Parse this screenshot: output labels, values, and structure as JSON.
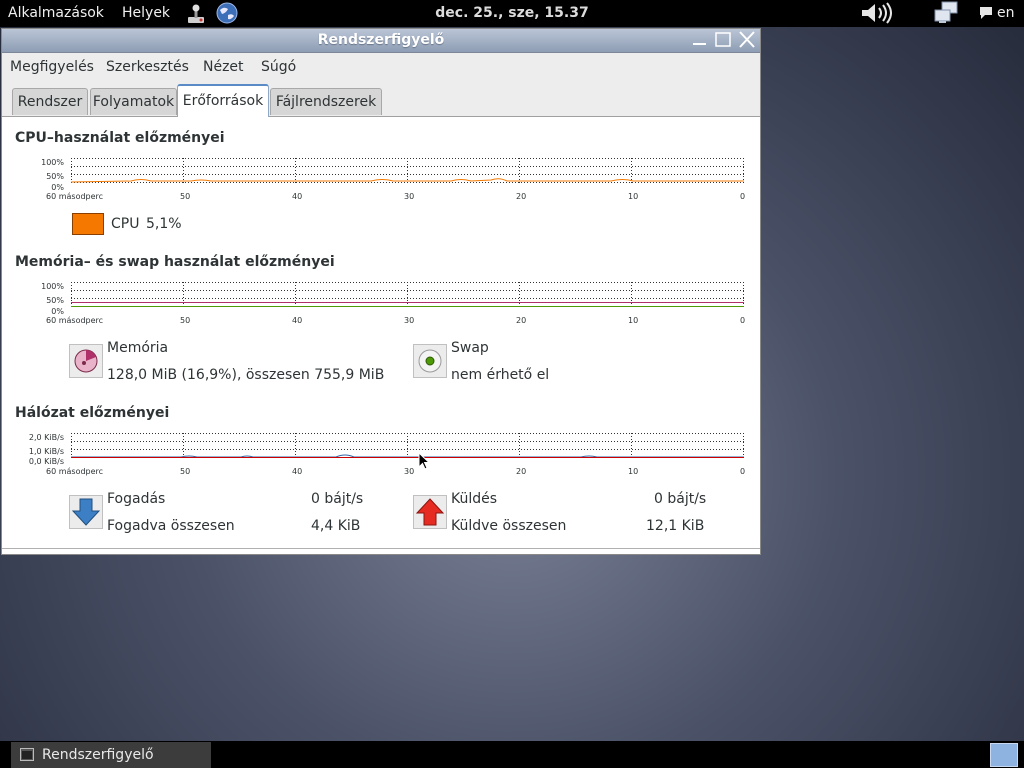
{
  "top_panel": {
    "applications": "Alkalmazások",
    "places": "Helyek",
    "clock": "dec. 25., sze, 15.37",
    "keyboard_layout": "en",
    "icons": [
      "joystick-icon",
      "globe-browser-icon",
      "volume-icon",
      "network-icon",
      "chat-icon"
    ]
  },
  "window": {
    "title": "Rendszerfigyelő",
    "menus": [
      "Megfigyelés",
      "Szerkesztés",
      "Nézet",
      "Súgó"
    ],
    "tabs": [
      "Rendszer",
      "Folyamatok",
      "Erőforrások",
      "Fájlrendszerek"
    ],
    "active_tab": "Erőforrások"
  },
  "cpu": {
    "title": "CPU–használat előzményei",
    "y_labels": [
      "100%",
      "50%",
      "0%"
    ],
    "x_labels": [
      "60 másodperc",
      "50",
      "40",
      "30",
      "20",
      "10",
      "0"
    ],
    "legend_label": "CPU",
    "legend_value": "5,1%",
    "color": "#f57900"
  },
  "memory": {
    "title": "Memória– és swap használat előzményei",
    "y_labels": [
      "100%",
      "50%",
      "0%"
    ],
    "x_labels": [
      "60 másodperc",
      "50",
      "40",
      "30",
      "20",
      "10",
      "0"
    ],
    "mem_label": "Memória",
    "mem_value": "128,0 MiB (16,9%), összesen 755,9 MiB",
    "swap_label": "Swap",
    "swap_value": "nem érhető el",
    "mem_color": "#b0306a",
    "swap_color": "#4e9a06"
  },
  "network": {
    "title": "Hálózat előzményei",
    "y_labels": [
      "2,0 KiB/s",
      "1,0 KiB/s",
      "0,0 KiB/s"
    ],
    "x_labels": [
      "60 másodperc",
      "50",
      "40",
      "30",
      "20",
      "10",
      "0"
    ],
    "recv_label": "Fogadás",
    "recv_rate": "0 bájt/s",
    "recv_total_label": "Fogadva összesen",
    "recv_total": "4,4 KiB",
    "send_label": "Küldés",
    "send_rate": "0 bájt/s",
    "send_total_label": "Küldve összesen",
    "send_total": "12,1 KiB",
    "recv_color": "#3465a4",
    "send_color": "#cc0000"
  },
  "taskbar": {
    "task_label": "Rendszerfigyelő"
  }
}
